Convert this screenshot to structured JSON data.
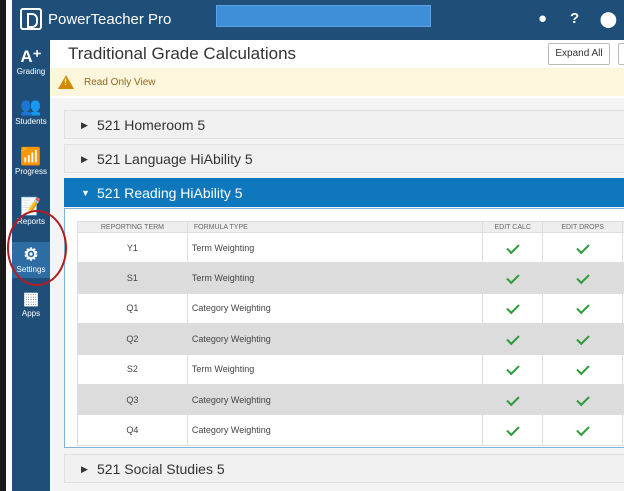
{
  "app": {
    "title": "PowerTeacher Pro"
  },
  "topbar": {
    "icons": [
      "bell-icon",
      "help-icon",
      "user-icon"
    ],
    "help_glyph": "?"
  },
  "nav": [
    {
      "id": "grading",
      "label": "Grading",
      "icon": "grading-icon",
      "glyph": "A⁺"
    },
    {
      "id": "students",
      "label": "Students",
      "icon": "students-icon",
      "glyph": "👥"
    },
    {
      "id": "progress",
      "label": "Progress",
      "icon": "progress-icon",
      "glyph": "📶"
    },
    {
      "id": "reports",
      "label": "Reports",
      "icon": "reports-icon",
      "glyph": "📝"
    },
    {
      "id": "settings",
      "label": "Settings",
      "icon": "gear-icon",
      "glyph": "⚙"
    },
    {
      "id": "apps",
      "label": "Apps",
      "icon": "apps-icon",
      "glyph": "▦"
    }
  ],
  "page": {
    "title": "Traditional Grade Calculations",
    "expand_label": "Expand All",
    "alert": "Read Only View"
  },
  "sections": [
    {
      "title": "521 Homeroom 5",
      "expanded": false
    },
    {
      "title": "521 Language HiAbility 5",
      "expanded": false
    },
    {
      "title": "521 Reading HiAbility 5",
      "expanded": true
    },
    {
      "title": "521 Social Studies 5",
      "expanded": false
    }
  ],
  "table": {
    "headers": [
      "REPORTING TERM",
      "FORMULA TYPE",
      "EDIT CALC",
      "EDIT DROPS"
    ],
    "rows": [
      {
        "term": "Y1",
        "formula": "Term Weighting",
        "edit_calc": true,
        "edit_drops": true
      },
      {
        "term": "S1",
        "formula": "Term Weighting",
        "edit_calc": true,
        "edit_drops": true
      },
      {
        "term": "Q1",
        "formula": "Category Weighting",
        "edit_calc": true,
        "edit_drops": true
      },
      {
        "term": "Q2",
        "formula": "Category Weighting",
        "edit_calc": true,
        "edit_drops": true
      },
      {
        "term": "S2",
        "formula": "Term Weighting",
        "edit_calc": true,
        "edit_drops": true
      },
      {
        "term": "Q3",
        "formula": "Category Weighting",
        "edit_calc": true,
        "edit_drops": true
      },
      {
        "term": "Q4",
        "formula": "Category Weighting",
        "edit_calc": true,
        "edit_drops": true
      }
    ]
  },
  "colors": {
    "nav": "#1f4e79",
    "accent": "#0f78bd",
    "check": "#2e9b3a",
    "highlight": "#b01c20"
  }
}
